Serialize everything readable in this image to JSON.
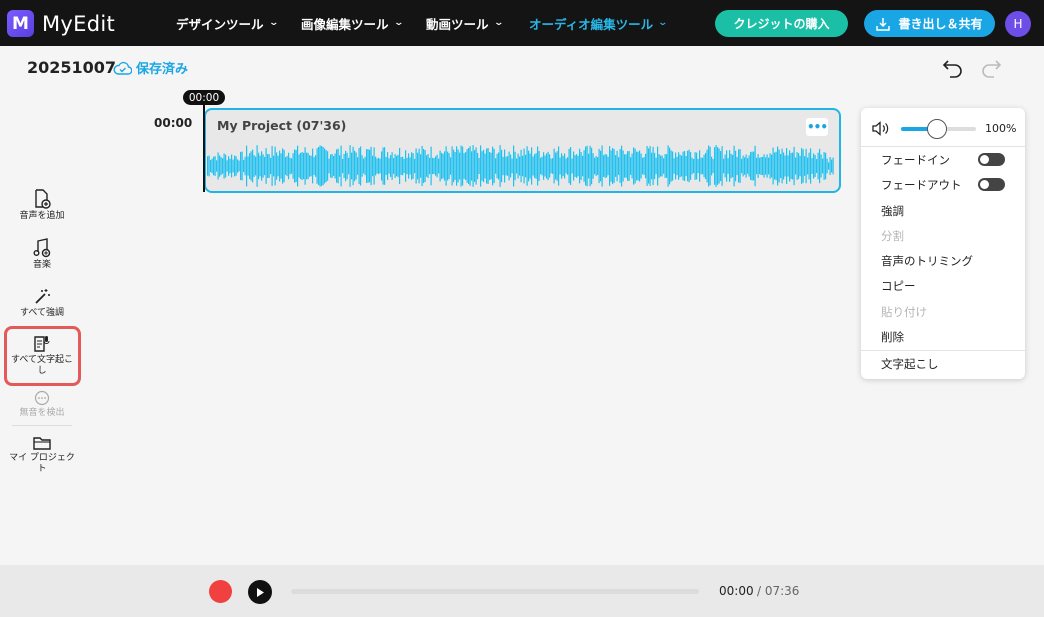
{
  "app": {
    "name": "MyEdit",
    "logo_letter": "M"
  },
  "nav": [
    {
      "label": "デザインツール"
    },
    {
      "label": "画像編集ツール"
    },
    {
      "label": "動画ツール"
    },
    {
      "label": "オーディオ編集ツール",
      "active": true
    }
  ],
  "header": {
    "credit_button": "クレジットの購入",
    "export_button": "書き出し＆共有",
    "avatar_initial": "H"
  },
  "project": {
    "title": "20251007",
    "save_status": "保存済み"
  },
  "sidebar": {
    "items": [
      {
        "label": "音声を追加",
        "icon": "add-file-icon"
      },
      {
        "label": "音楽",
        "icon": "music-note-icon"
      },
      {
        "label": "すべて強調",
        "icon": "magic-wand-icon"
      },
      {
        "label": "すべて文字起こし",
        "icon": "transcribe-icon",
        "highlighted": true
      },
      {
        "label": "無音を検出",
        "icon": "silence-dots-icon",
        "disabled": true
      },
      {
        "label": "マイ プロジェクト",
        "icon": "folder-icon"
      }
    ]
  },
  "timeline": {
    "playhead": "00:00",
    "start_time": "00:00",
    "clip": {
      "title": "My Project  (07'36)",
      "more_label": "•••"
    }
  },
  "context_menu": {
    "volume": "100%",
    "volume_level": 0.48,
    "items": [
      {
        "label": "フェードイン",
        "toggle": true,
        "disabled": false
      },
      {
        "label": "フェードアウト",
        "toggle": true,
        "disabled": false
      },
      {
        "label": "強調",
        "disabled": false
      },
      {
        "label": "分割",
        "disabled": true
      },
      {
        "label": "音声のトリミング",
        "disabled": false
      },
      {
        "label": "コピー",
        "disabled": false
      },
      {
        "label": "貼り付け",
        "disabled": true
      },
      {
        "label": "削除",
        "disabled": false
      },
      {
        "label": "文字起こし",
        "disabled": false
      }
    ]
  },
  "player": {
    "current": "00:00",
    "separator": " / ",
    "total": "07:36",
    "progress": 0
  },
  "colors": {
    "accent": "#1aa6e5",
    "credit": "#1bbfa6",
    "waveform": "#1fc1ef",
    "record": "#f04040"
  }
}
